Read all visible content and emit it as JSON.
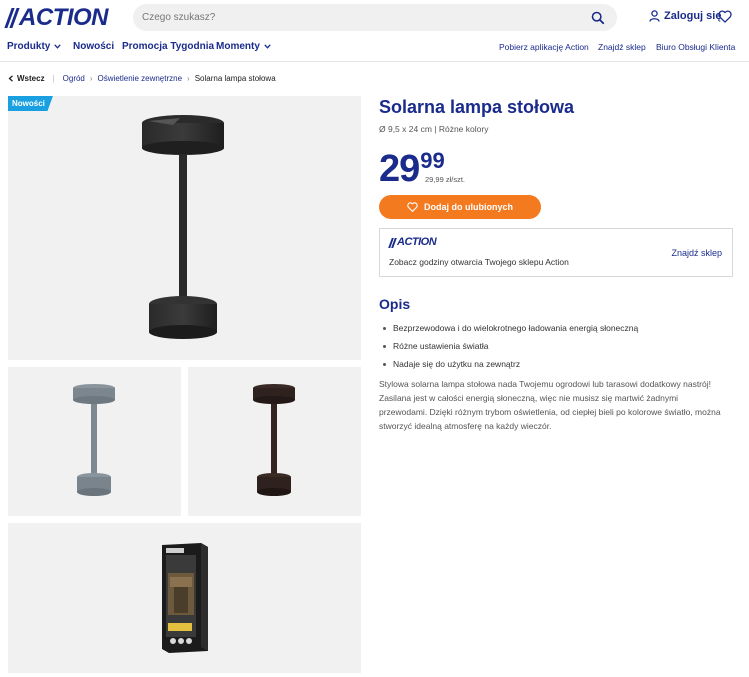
{
  "header": {
    "logo": "ACTION",
    "search_placeholder": "Czego szukasz?",
    "login_label": "Zaloguj się"
  },
  "nav": {
    "left": [
      {
        "label": "Produkty",
        "dropdown": true
      },
      {
        "label": "Nowości",
        "dropdown": false
      },
      {
        "label": "Promocja Tygodnia",
        "dropdown": false
      },
      {
        "label": "Momenty",
        "dropdown": true
      }
    ],
    "right": [
      "Pobierz aplikację Action",
      "Znajdź sklep",
      "Biuro Obsługi Klienta"
    ]
  },
  "breadcrumb": {
    "back": "Wstecz",
    "items": [
      "Ogród",
      "Oświetlenie zewnętrzne",
      "Solarna lampa stołowa"
    ]
  },
  "gallery": {
    "badge": "Nowości",
    "images": [
      {
        "name": "main-lamp-image",
        "icon": "black-table-lamp"
      },
      {
        "name": "grey-lamp-image",
        "icon": "grey-table-lamp"
      },
      {
        "name": "brown-lamp-image",
        "icon": "brown-table-lamp"
      },
      {
        "name": "package-image",
        "icon": "lamp-packaging-box"
      }
    ]
  },
  "product": {
    "title": "Solarna lampa stołowa",
    "subtitle": "Ø 9,5 x 24 cm | Różne kolory",
    "price_int": "29",
    "price_dec": "99",
    "unit_price": "29,99 zł/szt.",
    "fav_button": "Dodaj do ulubionych"
  },
  "store": {
    "logo": "ACTION",
    "text": "Zobacz godziny otwarcia Twojego sklepu Action",
    "link": "Znajdź sklep"
  },
  "description": {
    "heading": "Opis",
    "bullets": [
      "Bezprzewodowa i do wielokrotnego ładowania energią słoneczną",
      "Różne ustawienia światła",
      "Nadaje się do użytku na zewnątrz"
    ],
    "text": "Stylowa solarna lampa stołowa nada Twojemu ogrodowi lub tarasowi dodatkowy nastrój! Zasilana jest w całości energią słoneczną, więc nie musisz się martwić żadnymi przewodami. Dzięki różnym trybom oświetlenia, od ciepłej bieli po kolorowe światło, można stworzyć idealną atmosferę na każdy wieczór."
  },
  "colors": {
    "brand_blue": "#1a2b8c",
    "accent_orange": "#f47a20",
    "badge_blue": "#1aa0e0"
  }
}
